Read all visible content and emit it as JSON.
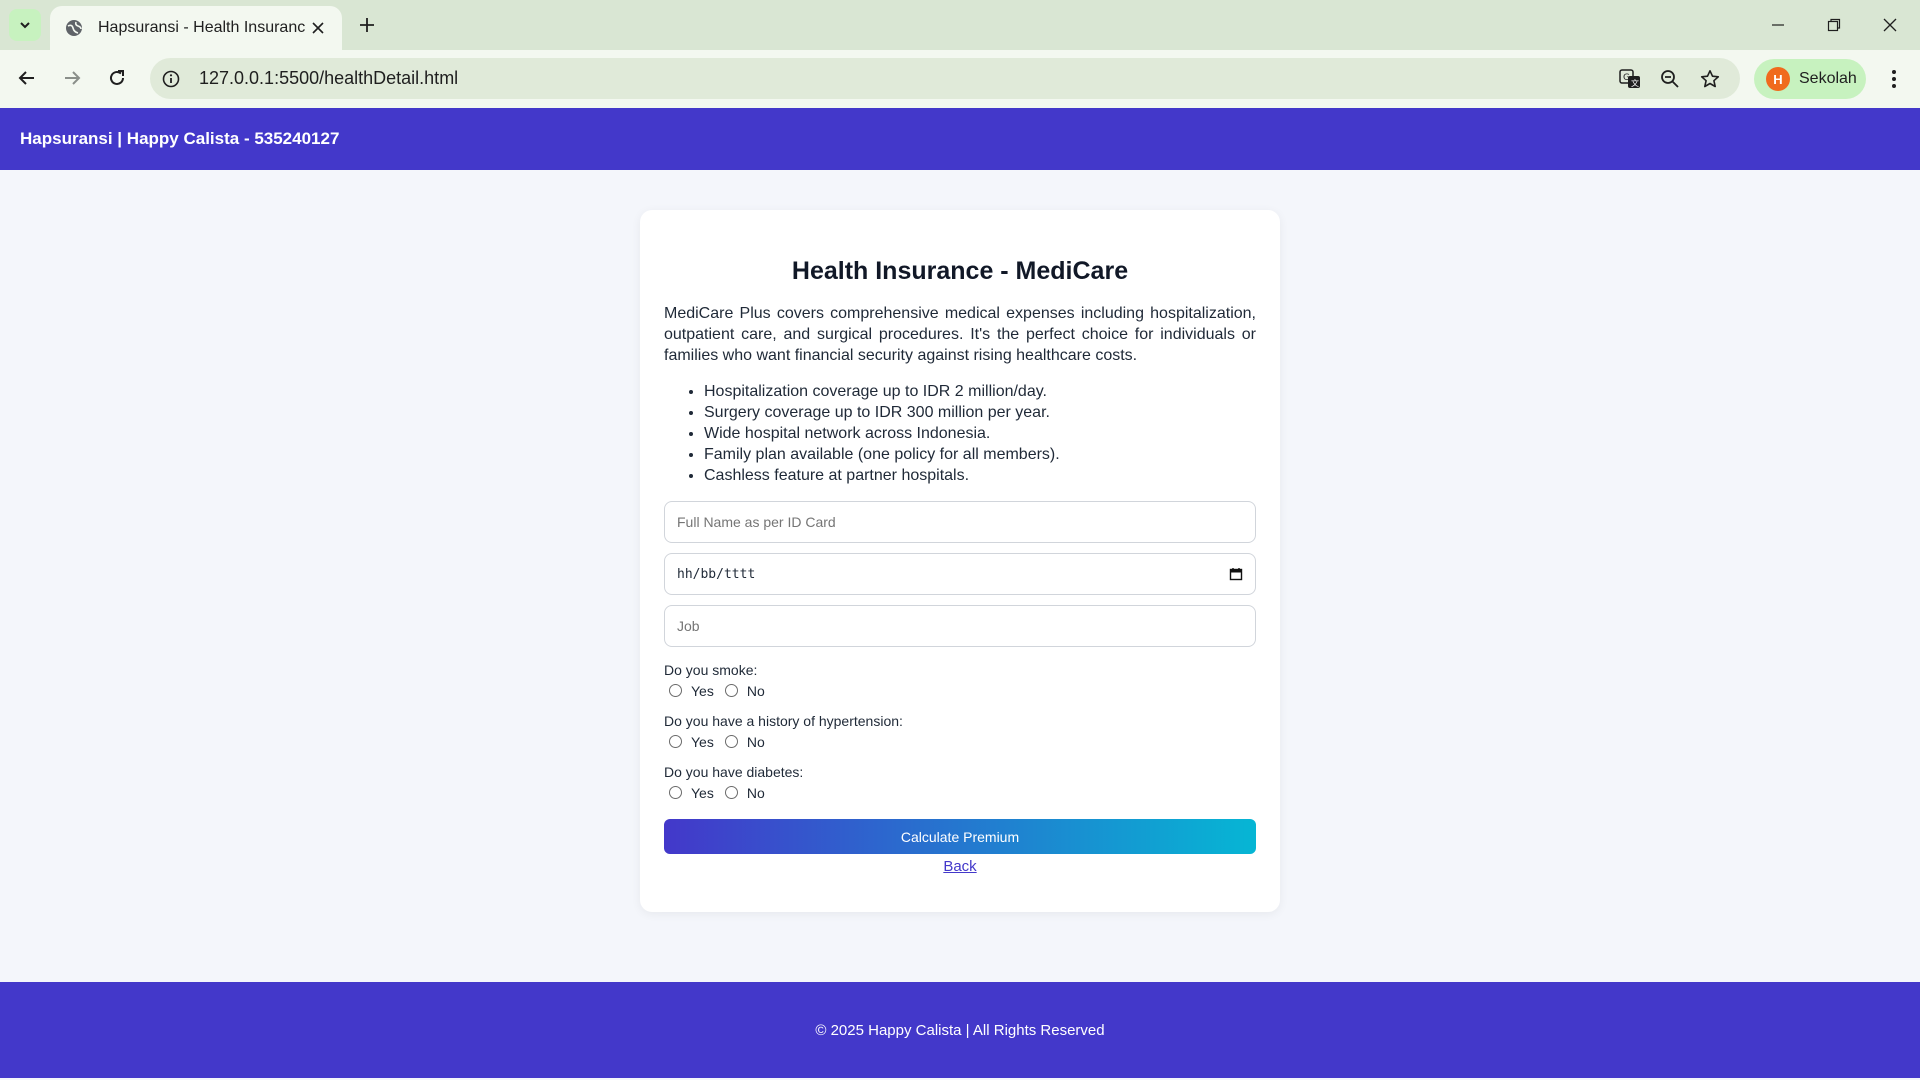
{
  "browser": {
    "tab_title": "Hapsuransi - Health Insurance",
    "url": "127.0.0.1:5500/healthDetail.html",
    "profile_initial": "H",
    "profile_name": "Sekolah"
  },
  "header": {
    "brand": "Hapsuransi | Happy Calista - 535240127"
  },
  "card": {
    "title": "Health Insurance - MediCare",
    "description": "MediCare Plus covers comprehensive medical expenses including hospitalization, outpatient care, and surgical procedures. It's the perfect choice for individuals or families who want financial security against rising healthcare costs.",
    "features": [
      "Hospitalization coverage up to IDR 2 million/day.",
      "Surgery coverage up to IDR 300 million per year.",
      "Wide hospital network across Indonesia.",
      "Family plan available (one policy for all members).",
      "Cashless feature at partner hospitals."
    ]
  },
  "form": {
    "name_placeholder": "Full Name as per ID Card",
    "date_placeholder": "hh/bb/tttt",
    "job_placeholder": "Job",
    "questions": [
      {
        "label": "Do you smoke:",
        "yes": "Yes",
        "no": "No"
      },
      {
        "label": "Do you have a history of hypertension:",
        "yes": "Yes",
        "no": "No"
      },
      {
        "label": "Do you have diabetes:",
        "yes": "Yes",
        "no": "No"
      }
    ],
    "submit_label": "Calculate Premium",
    "back_label": "Back"
  },
  "footer": {
    "copyright": "© 2025 Happy Calista | All Rights Reserved"
  },
  "colors": {
    "brand": "#4338ca",
    "gradient_end": "#06b6d4",
    "page_bg": "#f4f6fb"
  }
}
